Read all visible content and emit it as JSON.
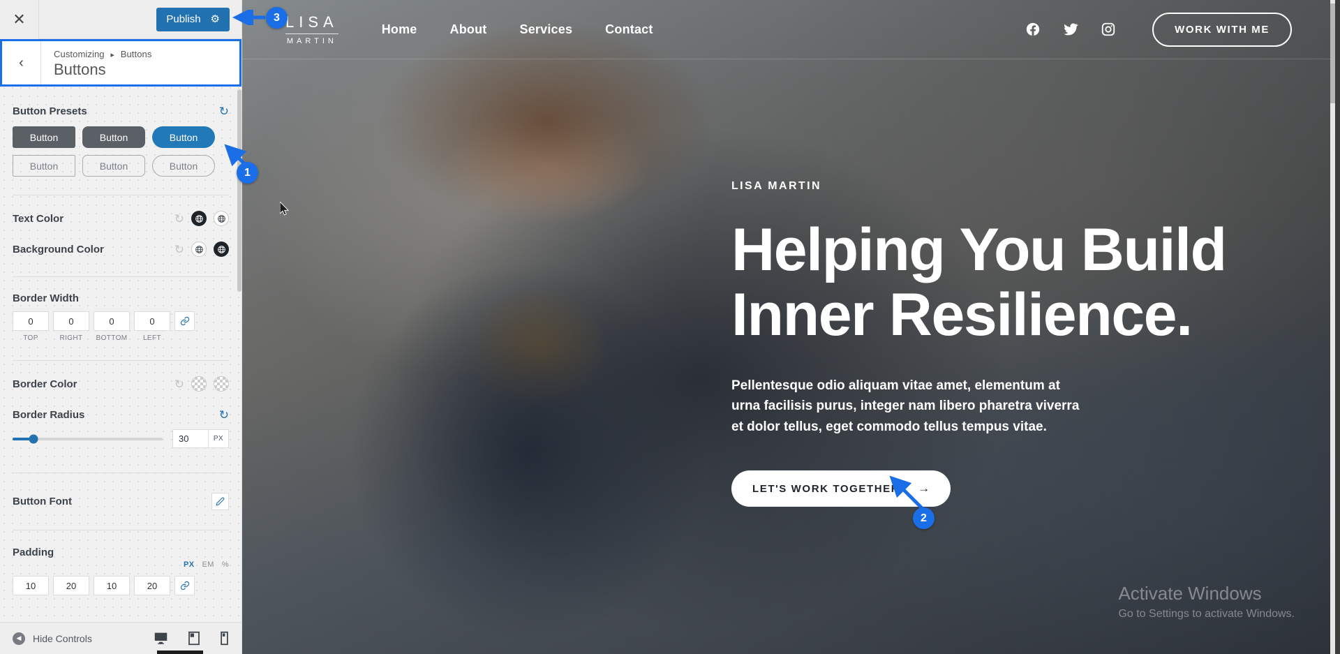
{
  "customizer": {
    "close_icon": "close-icon",
    "publish": {
      "label": "Publish",
      "gear_icon": "gear-icon",
      "color": "#2271b1"
    },
    "panel": {
      "back_icon": "chevron-left-icon",
      "breadcrumb_root": "Customizing",
      "breadcrumb_sep": "▸",
      "breadcrumb_current": "Buttons",
      "title": "Buttons",
      "highlight_color": "#1a6fe8"
    },
    "sections": {
      "button_presets": {
        "label": "Button Presets",
        "reset_icon": "reset-icon",
        "presets": [
          {
            "label": "Button",
            "style": "filled-square",
            "selected": false
          },
          {
            "label": "Button",
            "style": "filled-rounded",
            "selected": false
          },
          {
            "label": "Button",
            "style": "filled-pill",
            "selected": true
          },
          {
            "label": "Button",
            "style": "outline-square",
            "selected": false
          },
          {
            "label": "Button",
            "style": "outline-rounded",
            "selected": false
          },
          {
            "label": "Button",
            "style": "outline-pill",
            "selected": false
          }
        ]
      },
      "text_color": {
        "label": "Text Color",
        "reset_icon": "reset-icon",
        "swatches": [
          "dark",
          "light"
        ]
      },
      "background_color": {
        "label": "Background Color",
        "reset_icon": "reset-icon",
        "swatches": [
          "light",
          "dark"
        ]
      },
      "border_width": {
        "label": "Border Width",
        "fields": [
          {
            "value": "0",
            "caption": "TOP"
          },
          {
            "value": "0",
            "caption": "RIGHT"
          },
          {
            "value": "0",
            "caption": "BOTTOM"
          },
          {
            "value": "0",
            "caption": "LEFT"
          }
        ],
        "link_icon": "link-icon"
      },
      "border_color": {
        "label": "Border Color",
        "reset_icon": "reset-icon",
        "swatches": [
          "transparent",
          "transparent"
        ]
      },
      "border_radius": {
        "label": "Border Radius",
        "reset_icon": "reset-icon",
        "value": "30",
        "unit": "PX",
        "slider_percent": 14
      },
      "button_font": {
        "label": "Button Font",
        "edit_icon": "pencil-icon"
      },
      "padding": {
        "label": "Padding",
        "units": [
          "PX",
          "EM",
          "%"
        ],
        "active_unit": "PX",
        "fields": [
          {
            "value": "10"
          },
          {
            "value": "20"
          },
          {
            "value": "10"
          },
          {
            "value": "20"
          }
        ]
      }
    },
    "footer": {
      "hide_controls_label": "Hide Controls",
      "hide_icon": "collapse-arrow-icon",
      "devices": [
        {
          "name": "desktop-icon",
          "active": true
        },
        {
          "name": "tablet-icon",
          "active": false
        },
        {
          "name": "mobile-icon",
          "active": false
        }
      ]
    }
  },
  "preview": {
    "logo": {
      "line1": "LISA",
      "line2": "MARTIN"
    },
    "nav_links": [
      "Home",
      "About",
      "Services",
      "Contact"
    ],
    "socials": [
      "facebook-icon",
      "twitter-icon",
      "instagram-icon"
    ],
    "work_button": "WORK WITH ME",
    "hero": {
      "eyebrow": "LISA MARTIN",
      "title_line1": "Helping You Build",
      "title_line2": "Inner Resilience.",
      "description": "Pellentesque odio aliquam vitae amet, elementum at urna facilisis purus, integer nam libero pharetra viverra et dolor tellus, eget commodo tellus tempus vitae.",
      "cta_label": "LET'S WORK TOGETHER",
      "cta_arrow": "→"
    },
    "watermark": {
      "title": "Activate Windows",
      "subtitle": "Go to Settings to activate Windows."
    }
  },
  "annotations": [
    {
      "number": "1",
      "target": "selected-button-preset"
    },
    {
      "number": "2",
      "target": "hero-cta-button"
    },
    {
      "number": "3",
      "target": "publish-button"
    }
  ]
}
